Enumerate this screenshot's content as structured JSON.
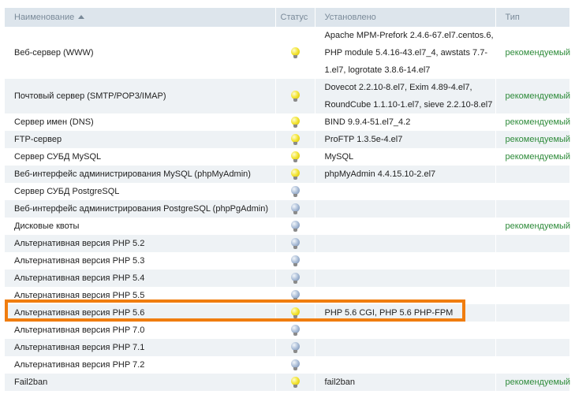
{
  "table": {
    "headers": {
      "name": "Наименование",
      "status": "Статус",
      "installed": "Установлено",
      "type": "Тип"
    },
    "rows": [
      {
        "name": "Веб-сервер (WWW)",
        "status": "on",
        "installed": [
          "Apache MPM-Prefork 2.4.6-67.el7.centos.6,",
          "PHP module 5.4.16-43.el7_4, awstats 7.7-",
          "1.el7, logrotate 3.8.6-14.el7"
        ],
        "type": "рекомендуемый"
      },
      {
        "name": "Почтовый сервер (SMTP/POP3/IMAP)",
        "status": "on",
        "installed": [
          "Dovecot 2.2.10-8.el7, Exim 4.89-4.el7,",
          "RoundCube 1.1.10-1.el7, sieve 2.2.10-8.el7"
        ],
        "type": "рекомендуемый"
      },
      {
        "name": "Сервер имен (DNS)",
        "status": "on",
        "installed": [
          "BIND 9.9.4-51.el7_4.2"
        ],
        "type": "рекомендуемый"
      },
      {
        "name": "FTP-сервер",
        "status": "on",
        "installed": [
          "ProFTP 1.3.5e-4.el7"
        ],
        "type": "рекомендуемый"
      },
      {
        "name": "Сервер СУБД MySQL",
        "status": "on",
        "installed": [
          "MySQL"
        ],
        "type": "рекомендуемый"
      },
      {
        "name": "Веб-интерфейс администрирования MySQL (phpMyAdmin)",
        "status": "on",
        "installed": [
          "phpMyAdmin 4.4.15.10-2.el7"
        ],
        "type": ""
      },
      {
        "name": "Сервер СУБД PostgreSQL",
        "status": "off",
        "installed": [
          ""
        ],
        "type": ""
      },
      {
        "name": "Веб-интерфейс администрирования PostgreSQL (phpPgAdmin)",
        "status": "off",
        "installed": [
          ""
        ],
        "type": ""
      },
      {
        "name": "Дисковые квоты",
        "status": "off",
        "installed": [
          ""
        ],
        "type": "рекомендуемый"
      },
      {
        "name": "Альтернативная версия PHP 5.2",
        "status": "off",
        "installed": [
          ""
        ],
        "type": ""
      },
      {
        "name": "Альтернативная версия PHP 5.3",
        "status": "off",
        "installed": [
          ""
        ],
        "type": ""
      },
      {
        "name": "Альтернативная версия PHP 5.4",
        "status": "off",
        "installed": [
          ""
        ],
        "type": ""
      },
      {
        "name": "Альтернативная версия PHP 5.5",
        "status": "off",
        "installed": [
          ""
        ],
        "type": ""
      },
      {
        "name": "Альтернативная версия PHP 5.6",
        "status": "on",
        "installed": [
          "PHP 5.6 CGI, PHP 5.6 PHP-FPM"
        ],
        "type": ""
      },
      {
        "name": "Альтернативная версия PHP 7.0",
        "status": "off",
        "installed": [
          ""
        ],
        "type": ""
      },
      {
        "name": "Альтернативная версия PHP 7.1",
        "status": "off",
        "installed": [
          ""
        ],
        "type": ""
      },
      {
        "name": "Альтернативная версия PHP 7.2",
        "status": "off",
        "installed": [
          ""
        ],
        "type": ""
      },
      {
        "name": "Fail2ban",
        "status": "on",
        "installed": [
          "fail2ban"
        ],
        "type": "рекомендуемый"
      }
    ],
    "highlighted_row": "Альтернативная версия PHP 5.6"
  },
  "colors": {
    "header_bg": "#dde5ec",
    "row_alt_bg": "#eef2f5",
    "recommended_text": "#2e8b3a",
    "highlight_border": "#f07d0f"
  },
  "icons": {
    "status_on": "lightbulb-on-icon",
    "status_off": "lightbulb-off-icon",
    "sort": "sort-ascending-icon"
  }
}
